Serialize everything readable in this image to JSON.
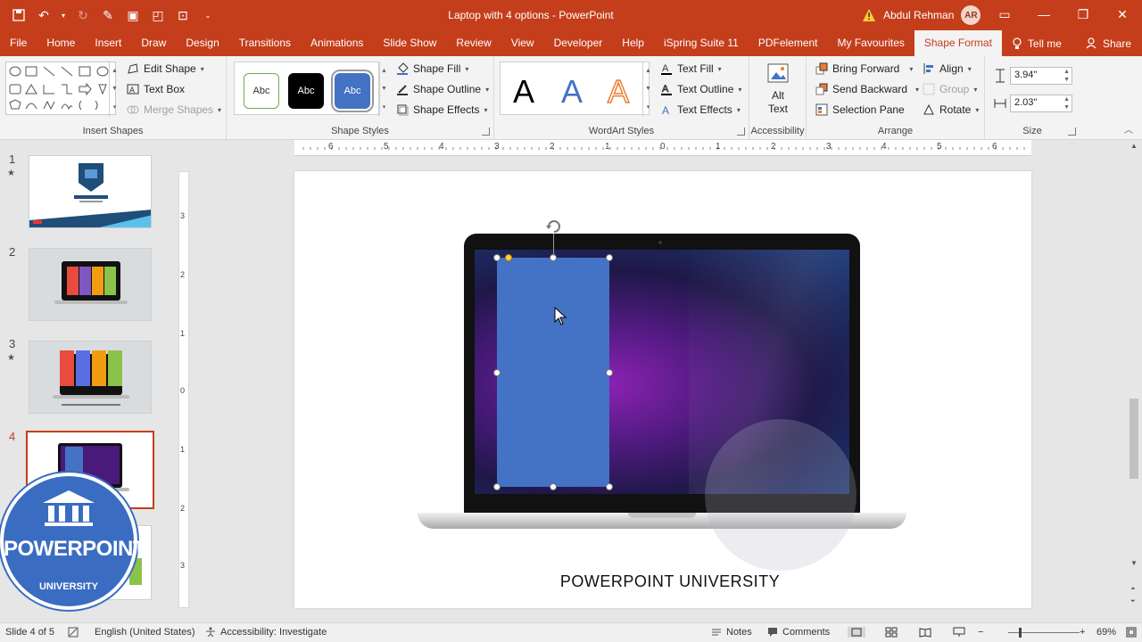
{
  "window": {
    "title": "Laptop with 4 options  -  PowerPoint",
    "user_name": "Abdul Rehman",
    "user_initials": "AR",
    "accent": "#c43e1c"
  },
  "tabs": [
    "File",
    "Home",
    "Insert",
    "Draw",
    "Design",
    "Transitions",
    "Animations",
    "Slide Show",
    "Review",
    "View",
    "Developer",
    "Help",
    "iSpring Suite 11",
    "PDFelement",
    "My Favourites",
    "Shape Format"
  ],
  "active_tab": "Shape Format",
  "tell_me": "Tell me",
  "share": "Share",
  "ribbon": {
    "insert_shapes": {
      "label": "Insert Shapes",
      "edit_shape": "Edit Shape",
      "text_box": "Text Box",
      "merge_shapes": "Merge Shapes"
    },
    "shape_styles": {
      "label": "Shape Styles",
      "style1": "Abc",
      "style2": "Abc",
      "style3": "Abc",
      "fill": "Shape Fill",
      "outline": "Shape Outline",
      "effects": "Shape Effects"
    },
    "wordart": {
      "label": "WordArt Styles",
      "letter": "A",
      "text_fill": "Text Fill",
      "text_outline": "Text Outline",
      "text_effects": "Text Effects"
    },
    "accessibility": {
      "label": "Accessibility",
      "alt_text_1": "Alt",
      "alt_text_2": "Text"
    },
    "arrange": {
      "label": "Arrange",
      "bring_forward": "Bring Forward",
      "send_backward": "Send Backward",
      "selection_pane": "Selection Pane",
      "align": "Align",
      "group": "Group",
      "rotate": "Rotate"
    },
    "size": {
      "label": "Size",
      "height": "3.94\"",
      "width": "2.03\""
    }
  },
  "ruler_numbers": [
    "6",
    "5",
    "4",
    "3",
    "2",
    "1",
    "0",
    "1",
    "2",
    "3",
    "4",
    "5",
    "6"
  ],
  "vruler_numbers": [
    "3",
    "2",
    "1",
    "0",
    "1",
    "2",
    "3"
  ],
  "slides": [
    {
      "num": "1",
      "star": "★"
    },
    {
      "num": "2",
      "star": ""
    },
    {
      "num": "3",
      "star": "★"
    },
    {
      "num": "4",
      "star": ""
    }
  ],
  "slide": {
    "caption": "POWERPOINT UNIVERSITY"
  },
  "logo": {
    "text": "POWERPOINT",
    "sub": "UNIVERSITY"
  },
  "status": {
    "slide_of": "Slide 4 of 5",
    "language": "English (United States)",
    "accessibility": "Accessibility: Investigate",
    "notes": "Notes",
    "comments": "Comments",
    "zoom": "69%"
  }
}
